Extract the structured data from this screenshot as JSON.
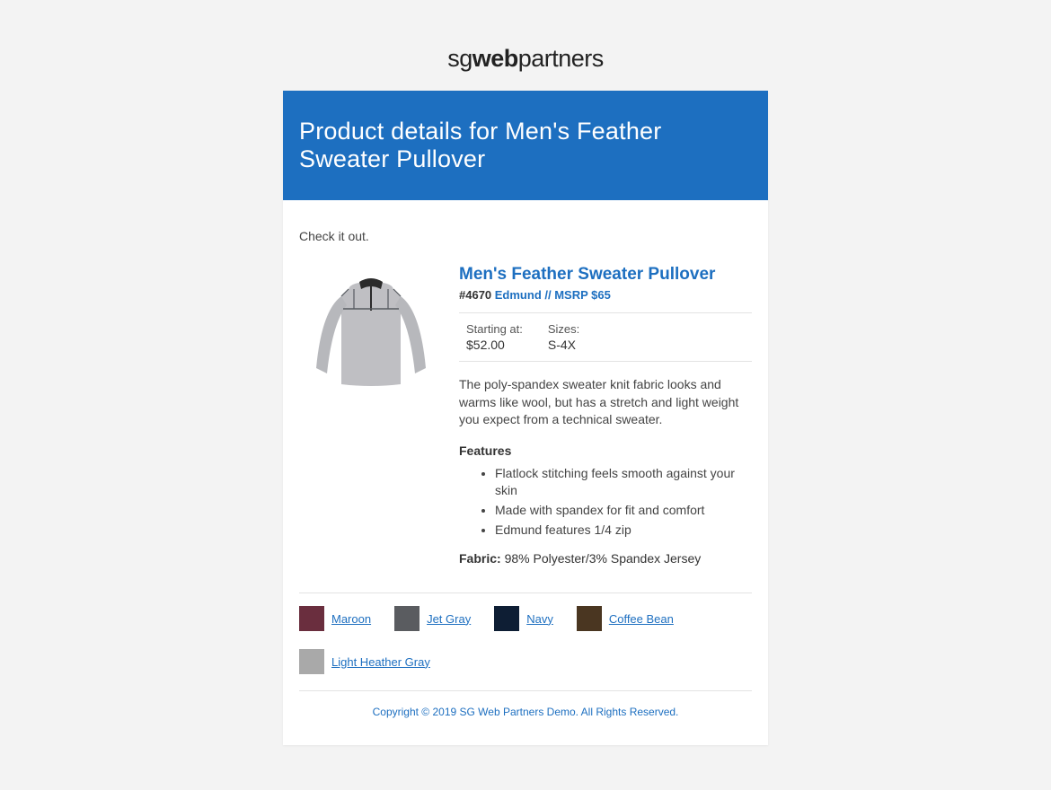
{
  "brand": {
    "prefix": "sg",
    "bold": "web",
    "suffix": "partners"
  },
  "hero_title": "Product details for Men's Feather Sweater Pullover",
  "intro": "Check it out.",
  "product": {
    "title": "Men's Feather Sweater Pullover",
    "sku_prefix": "#4670 ",
    "sku_link_text": "Edmund // MSRP $65",
    "starting_label": "Starting at:",
    "starting_value": "$52.00",
    "sizes_label": "Sizes:",
    "sizes_value": "S-4X",
    "description": "The poly-spandex sweater knit fabric looks and warms like wool, but has a stretch and light weight you expect from a technical sweater.",
    "features_label": "Features",
    "features": [
      "Flatlock stitching feels smooth against your skin",
      "Made with spandex for fit and comfort",
      "Edmund features 1/4 zip"
    ],
    "fabric_label": "Fabric:",
    "fabric_value": " 98% Polyester/3% Spandex Jersey"
  },
  "swatches": [
    {
      "name": "Maroon",
      "color": "#6a2e3e"
    },
    {
      "name": "Jet Gray",
      "color": "#5a5c60"
    },
    {
      "name": "Navy",
      "color": "#0e1e34"
    },
    {
      "name": "Coffee Bean",
      "color": "#4a3621"
    },
    {
      "name": "Light Heather Gray",
      "color": "#a9a9a9"
    }
  ],
  "footer": "Copyright © 2019 SG Web Partners Demo. All Rights Reserved."
}
